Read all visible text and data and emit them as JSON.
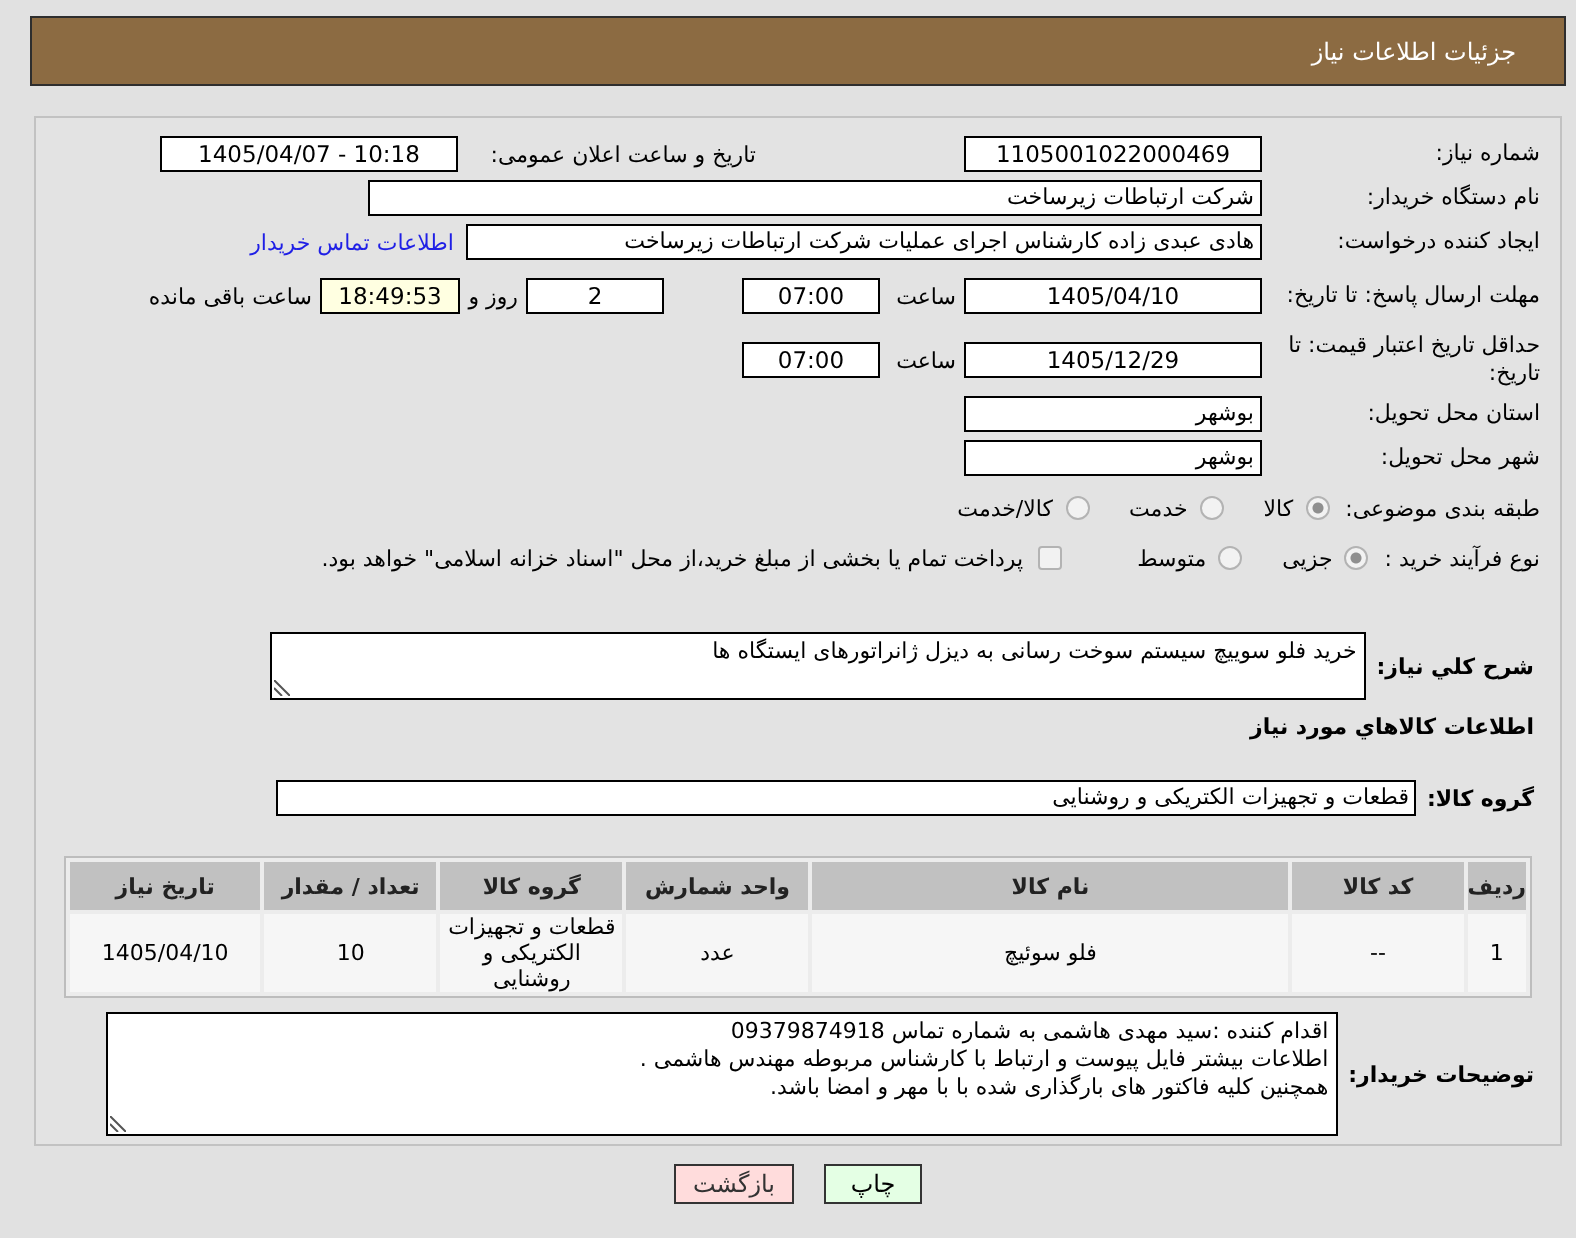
{
  "header": {
    "title": "جزئیات اطلاعات نیاز"
  },
  "form": [
    {
      "kind": "pair",
      "label": "شماره نیاز:",
      "value": "1105001022000469",
      "second_label": "تاریخ و ساعت اعلان عمومی:",
      "second_value": "1405/04/07 - 10:18"
    },
    {
      "kind": "wide",
      "label": "نام دستگاه خریدار:",
      "value": "شرکت ارتباطات زیرساخت"
    },
    {
      "kind": "link",
      "label": "ایجاد کننده درخواست:",
      "value": "هادی عبدی زاده کارشناس اجرای عملیات شرکت ارتباطات زیرساخت",
      "link": "اطلاعات تماس خریدار"
    },
    {
      "kind": "deadline",
      "label": "مهلت ارسال پاسخ: تا تاریخ:",
      "date": "1405/04/10",
      "time_label": "ساعت",
      "time": "07:00",
      "days": "2",
      "days_label": "روز و",
      "remaining": "18:49:53",
      "remaining_label": "ساعت باقی مانده"
    },
    {
      "kind": "deadline",
      "label": "حداقل تاریخ اعتبار قیمت: تا تاریخ:",
      "date": "1405/12/29",
      "time_label": "ساعت",
      "time": "07:00"
    },
    {
      "kind": "short",
      "label": "استان محل تحویل:",
      "value": "بوشهر"
    },
    {
      "kind": "short",
      "label": "شهر محل تحویل:",
      "value": "بوشهر"
    },
    {
      "kind": "radios",
      "label": "طبقه بندی موضوعی:",
      "options": [
        {
          "label": "کالا",
          "selected": true
        },
        {
          "label": "خدمت",
          "selected": false
        },
        {
          "label": "کالا/خدمت",
          "selected": false
        }
      ]
    },
    {
      "kind": "radios",
      "label": "نوع فرآیند خرید :",
      "options": [
        {
          "label": "جزیی",
          "selected": true
        },
        {
          "label": "متوسط",
          "selected": false
        }
      ],
      "checkbox": {
        "label": "پرداخت تمام یا بخشی از مبلغ خرید،از محل \"اسناد خزانه اسلامی\" خواهد بود.",
        "checked": false
      }
    }
  ],
  "description": {
    "label": "شرح کلي نياز:",
    "value": "خرید فلو سوییچ سیستم سوخت رسانی به دیزل ژانراتورهای ایستگاه ها"
  },
  "goods": {
    "title": "اطلاعات کالاهاي مورد نياز",
    "group_label": "گروه کالا:",
    "group_value": "قطعات و تجهیزات الکتریکی و روشنایی"
  },
  "table": {
    "columns": [
      "ردیف",
      "کد کالا",
      "نام کالا",
      "واحد شمارش",
      "گروه کالا",
      "تعداد / مقدار",
      "تاریخ نیاز"
    ],
    "rows": [
      [
        "1",
        "--",
        "فلو سوئیچ",
        "عدد",
        "قطعات و تجهیزات الکتریکی و روشنایی",
        "10",
        "1405/04/10"
      ]
    ]
  },
  "buyer_notes": {
    "label": "توضیحات خریدار:",
    "lines": [
      "اقدام کننده :سید مهدی هاشمی به شماره تماس 09379874918",
      "اطلاعات بیشتر فایل پیوست و ارتباط با کارشناس مربوطه مهندس هاشمی .",
      "همچنین کلیه فاکتور های بارگذاری شده با با مهر و امضا باشد."
    ]
  },
  "buttons": [
    {
      "label": "چاپ",
      "kind": "print"
    },
    {
      "label": "بازگشت",
      "kind": "back"
    }
  ]
}
